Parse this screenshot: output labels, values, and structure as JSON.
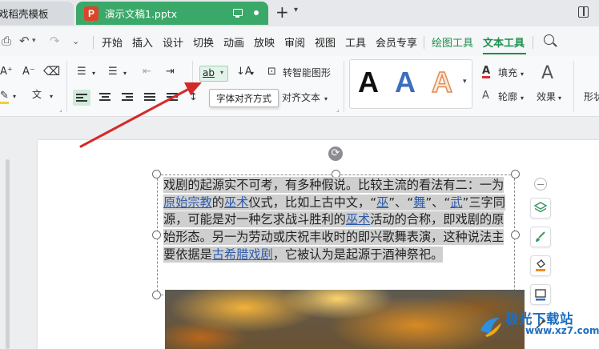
{
  "tabs": {
    "docer": "戏稻壳模板",
    "doc_logo": "P",
    "doc_title": "演示文稿1.pptx"
  },
  "menu": {
    "items": [
      "开始",
      "插入",
      "设计",
      "切换",
      "动画",
      "放映",
      "审阅",
      "视图",
      "工具",
      "会员专享"
    ],
    "drawing_tools": "绘图工具",
    "text_tools": "文本工具"
  },
  "ribbon": {
    "font_grow": "A⁺",
    "font_shrink": "A⁻",
    "ab_button": "ab",
    "smart_shape": "转智能图形",
    "align_text": "对齐文本",
    "fill": "填充",
    "outline": "轮廓",
    "effects": "效果",
    "shape_partial": "形状",
    "style_letter": "A",
    "pinyin_label": "文"
  },
  "tooltip": "字体对齐方式",
  "textbox": {
    "seg1": "戏剧的起源实不可考，有多种假说。比较主流的看法有二：一为",
    "link1": "原始宗教",
    "seg2": "的",
    "link2": "巫术",
    "seg3": "仪式，比如上古中文，“",
    "link3": "巫",
    "seg4": "”、“",
    "link4": "舞",
    "seg5": "”、“",
    "link5": "武",
    "seg6": "”三字同源，可能是对一种乞求战斗胜利的",
    "link6": "巫术",
    "seg7": "活动的合称，即戏剧的原始形态。另一为劳动或庆祝丰收时的即兴歌舞表演，这种说法主要依据是",
    "link7": "古希腊戏剧",
    "seg8": "，它被认为是起源于酒神祭祀。"
  },
  "watermark": {
    "text": "极光下载站",
    "url": "www.xz7.com"
  },
  "colors": {
    "accent_green": "#1c8f4f",
    "tab_green": "#3aa868",
    "arrow_red": "#d42a2a",
    "link_blue": "#2e5bab"
  }
}
